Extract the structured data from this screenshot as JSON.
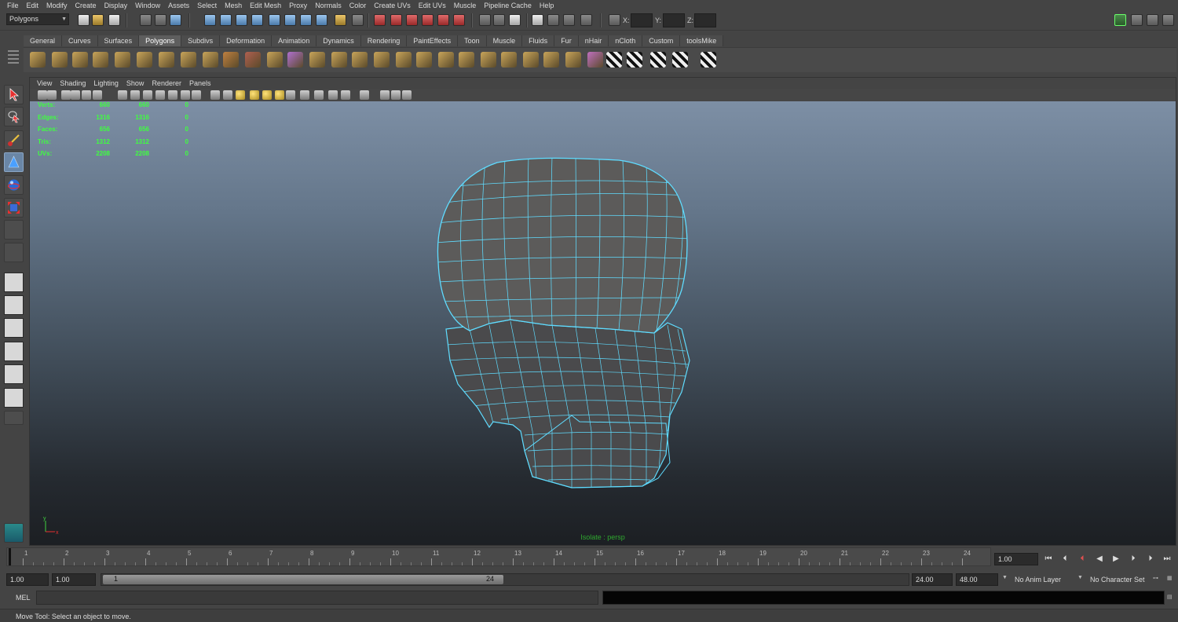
{
  "menubar": {
    "items": [
      "File",
      "Edit",
      "Modify",
      "Create",
      "Display",
      "Window",
      "Assets",
      "Select",
      "Mesh",
      "Edit Mesh",
      "Proxy",
      "Normals",
      "Color",
      "Create UVs",
      "Edit UVs",
      "Muscle",
      "Pipeline Cache",
      "Help"
    ]
  },
  "statusline": {
    "mode": "Polygons",
    "x_label": "X:",
    "y_label": "Y:",
    "z_label": "Z:"
  },
  "shelf": {
    "tabs": [
      "General",
      "Curves",
      "Surfaces",
      "Polygons",
      "Subdivs",
      "Deformation",
      "Animation",
      "Dynamics",
      "Rendering",
      "PaintEffects",
      "Toon",
      "Muscle",
      "Fluids",
      "Fur",
      "nHair",
      "nCloth",
      "Custom",
      "toolsMike"
    ],
    "active_tab": "Polygons"
  },
  "panel": {
    "menus": [
      "View",
      "Shading",
      "Lighting",
      "Show",
      "Renderer",
      "Panels"
    ],
    "camera_label": "Isolate : persp"
  },
  "hud": {
    "rows": [
      {
        "label": "Verts:",
        "v1": "660",
        "v2": "660",
        "v3": "0"
      },
      {
        "label": "Edges:",
        "v1": "1316",
        "v2": "1316",
        "v3": "0"
      },
      {
        "label": "Faces:",
        "v1": "656",
        "v2": "656",
        "v3": "0"
      },
      {
        "label": "Tris:",
        "v1": "1312",
        "v2": "1312",
        "v3": "0"
      },
      {
        "label": "UVs:",
        "v1": "2208",
        "v2": "2208",
        "v3": "0"
      }
    ]
  },
  "axis_gizmo": {
    "y": "y",
    "x": "x"
  },
  "timeline": {
    "ticks": [
      "1",
      "2",
      "3",
      "4",
      "5",
      "6",
      "7",
      "8",
      "9",
      "10",
      "11",
      "12",
      "13",
      "14",
      "15",
      "16",
      "17",
      "18",
      "19",
      "20",
      "21",
      "22",
      "23",
      "24"
    ],
    "current_time": "1.00"
  },
  "range": {
    "start": "1.00",
    "playback_start": "1.00",
    "range_start_label": "1",
    "range_end_label": "24",
    "playback_end": "24.00",
    "end": "48.00",
    "anim_layer": "No Anim Layer",
    "character_set": "No Character Set"
  },
  "commandline": {
    "label": "MEL"
  },
  "helpline": {
    "text": "Move Tool: Select an object to move."
  },
  "colors": {
    "wire": "#5fdcff",
    "hud_text": "#3fff3f",
    "mesh_fill": "#5a5a5a"
  }
}
